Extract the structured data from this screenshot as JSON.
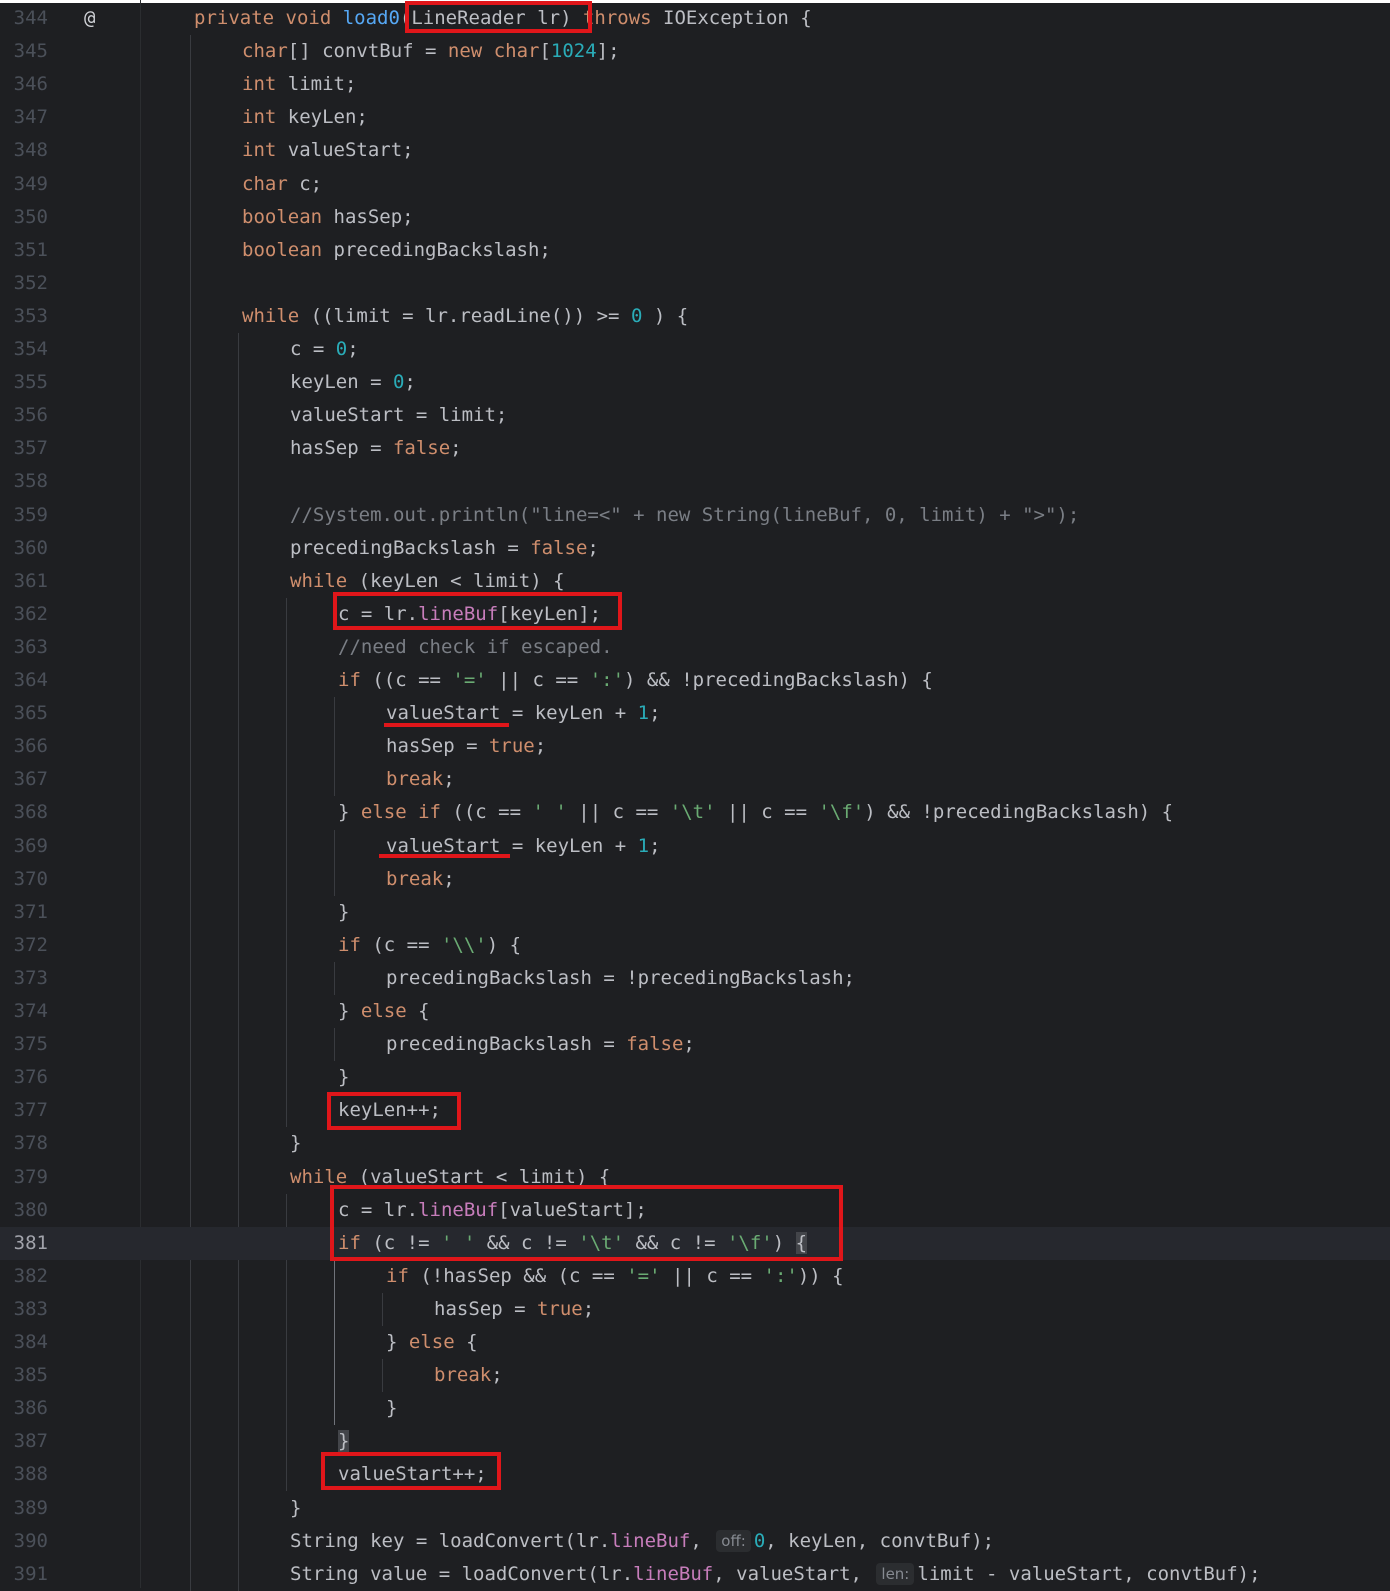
{
  "editor": {
    "lines": [
      {
        "n": "344",
        "indent": 0,
        "marker": "@",
        "tokens": [
          [
            "kw",
            "private"
          ],
          [
            "",
            ""
          ],
          [
            "kw",
            " void "
          ],
          [
            "fn",
            "load0"
          ],
          [
            "",
            "(LineReader lr) "
          ],
          [
            "kw",
            "throws"
          ],
          [
            "",
            " IOException {"
          ]
        ]
      },
      {
        "n": "345",
        "indent": 1,
        "tokens": [
          [
            "kw",
            "char"
          ],
          [
            "",
            "[] convtBuf = "
          ],
          [
            "kw",
            "new "
          ],
          [
            "kw",
            "char"
          ],
          [
            "",
            "["
          ],
          [
            "num",
            "1024"
          ],
          [
            "",
            "];"
          ]
        ]
      },
      {
        "n": "346",
        "indent": 1,
        "tokens": [
          [
            "kw",
            "int"
          ],
          [
            "",
            " limit;"
          ]
        ]
      },
      {
        "n": "347",
        "indent": 1,
        "tokens": [
          [
            "kw",
            "int"
          ],
          [
            "",
            " keyLen;"
          ]
        ]
      },
      {
        "n": "348",
        "indent": 1,
        "tokens": [
          [
            "kw",
            "int"
          ],
          [
            "",
            " valueStart;"
          ]
        ]
      },
      {
        "n": "349",
        "indent": 1,
        "tokens": [
          [
            "kw",
            "char"
          ],
          [
            "",
            " c;"
          ]
        ]
      },
      {
        "n": "350",
        "indent": 1,
        "tokens": [
          [
            "kw",
            "boolean"
          ],
          [
            "",
            " hasSep;"
          ]
        ]
      },
      {
        "n": "351",
        "indent": 1,
        "tokens": [
          [
            "kw",
            "boolean"
          ],
          [
            "",
            " precedingBackslash;"
          ]
        ]
      },
      {
        "n": "352",
        "indent": 1,
        "tokens": []
      },
      {
        "n": "353",
        "indent": 1,
        "tokens": [
          [
            "kw",
            "while"
          ],
          [
            "",
            " ((limit = lr.readLine()) >= "
          ],
          [
            "num",
            "0"
          ],
          [
            "",
            " ) {"
          ]
        ]
      },
      {
        "n": "354",
        "indent": 2,
        "tokens": [
          [
            "",
            "c = "
          ],
          [
            "num",
            "0"
          ],
          [
            "",
            ";"
          ]
        ]
      },
      {
        "n": "355",
        "indent": 2,
        "tokens": [
          [
            "",
            "keyLen = "
          ],
          [
            "num",
            "0"
          ],
          [
            "",
            ";"
          ]
        ]
      },
      {
        "n": "356",
        "indent": 2,
        "tokens": [
          [
            "",
            "valueStart = limit;"
          ]
        ]
      },
      {
        "n": "357",
        "indent": 2,
        "tokens": [
          [
            "",
            "hasSep = "
          ],
          [
            "kw",
            "false"
          ],
          [
            "",
            ";"
          ]
        ]
      },
      {
        "n": "358",
        "indent": 2,
        "tokens": []
      },
      {
        "n": "359",
        "indent": 2,
        "tokens": [
          [
            "cmt",
            "//System.out.println(\"line=<\" + new String(lineBuf, 0, limit) + \">\");"
          ]
        ]
      },
      {
        "n": "360",
        "indent": 2,
        "tokens": [
          [
            "",
            "precedingBackslash = "
          ],
          [
            "kw",
            "false"
          ],
          [
            "",
            ";"
          ]
        ]
      },
      {
        "n": "361",
        "indent": 2,
        "tokens": [
          [
            "kw",
            "while"
          ],
          [
            "",
            " (keyLen < limit) {"
          ]
        ]
      },
      {
        "n": "362",
        "indent": 3,
        "tokens": [
          [
            "",
            "c = lr."
          ],
          [
            "fld",
            "lineBuf"
          ],
          [
            "",
            "[keyLen];"
          ]
        ]
      },
      {
        "n": "363",
        "indent": 3,
        "tokens": [
          [
            "cmt",
            "//need check if escaped."
          ]
        ]
      },
      {
        "n": "364",
        "indent": 3,
        "tokens": [
          [
            "kw",
            "if"
          ],
          [
            "",
            " ((c == "
          ],
          [
            "str",
            "'='"
          ],
          [
            "",
            " || c == "
          ],
          [
            "str",
            "':'"
          ],
          [
            "",
            ") && !precedingBackslash) {"
          ]
        ]
      },
      {
        "n": "365",
        "indent": 4,
        "tokens": [
          [
            "",
            "valueStart = keyLen + "
          ],
          [
            "num",
            "1"
          ],
          [
            "",
            ";"
          ]
        ]
      },
      {
        "n": "366",
        "indent": 4,
        "tokens": [
          [
            "",
            "hasSep = "
          ],
          [
            "kw",
            "true"
          ],
          [
            "",
            ";"
          ]
        ]
      },
      {
        "n": "367",
        "indent": 4,
        "tokens": [
          [
            "kw",
            "break"
          ],
          [
            "",
            ";"
          ]
        ]
      },
      {
        "n": "368",
        "indent": 3,
        "tokens": [
          [
            "",
            "} "
          ],
          [
            "kw",
            "else if"
          ],
          [
            "",
            " ((c == "
          ],
          [
            "str",
            "' '"
          ],
          [
            "",
            " || c == "
          ],
          [
            "str",
            "'\\t'"
          ],
          [
            "",
            " || c == "
          ],
          [
            "str",
            "'\\f'"
          ],
          [
            "",
            ") && !precedingBackslash) {"
          ]
        ]
      },
      {
        "n": "369",
        "indent": 4,
        "tokens": [
          [
            "",
            "valueStart = keyLen + "
          ],
          [
            "num",
            "1"
          ],
          [
            "",
            ";"
          ]
        ]
      },
      {
        "n": "370",
        "indent": 4,
        "tokens": [
          [
            "kw",
            "break"
          ],
          [
            "",
            ";"
          ]
        ]
      },
      {
        "n": "371",
        "indent": 3,
        "tokens": [
          [
            "",
            "}"
          ]
        ]
      },
      {
        "n": "372",
        "indent": 3,
        "tokens": [
          [
            "kw",
            "if"
          ],
          [
            "",
            " (c == "
          ],
          [
            "str",
            "'\\\\'"
          ],
          [
            "",
            ") {"
          ]
        ]
      },
      {
        "n": "373",
        "indent": 4,
        "tokens": [
          [
            "",
            "precedingBackslash = !precedingBackslash;"
          ]
        ]
      },
      {
        "n": "374",
        "indent": 3,
        "tokens": [
          [
            "",
            "} "
          ],
          [
            "kw",
            "else"
          ],
          [
            "",
            " {"
          ]
        ]
      },
      {
        "n": "375",
        "indent": 4,
        "tokens": [
          [
            "",
            "precedingBackslash = "
          ],
          [
            "kw",
            "false"
          ],
          [
            "",
            ";"
          ]
        ]
      },
      {
        "n": "376",
        "indent": 3,
        "tokens": [
          [
            "",
            "}"
          ]
        ]
      },
      {
        "n": "377",
        "indent": 3,
        "tokens": [
          [
            "",
            "keyLen++;"
          ]
        ]
      },
      {
        "n": "378",
        "indent": 2,
        "tokens": [
          [
            "",
            "}"
          ]
        ]
      },
      {
        "n": "379",
        "indent": 2,
        "tokens": [
          [
            "kw",
            "while"
          ],
          [
            "",
            " (valueStart < limit) {"
          ]
        ]
      },
      {
        "n": "380",
        "indent": 3,
        "tokens": [
          [
            "",
            "c = lr."
          ],
          [
            "fld",
            "lineBuf"
          ],
          [
            "",
            "[valueStart];"
          ]
        ]
      },
      {
        "n": "381",
        "indent": 3,
        "current": true,
        "tokens": [
          [
            "kw",
            "if"
          ],
          [
            "",
            " (c != "
          ],
          [
            "str",
            "' '"
          ],
          [
            "",
            " && c != "
          ],
          [
            "str",
            "'\\t'"
          ],
          [
            "",
            " && c != "
          ],
          [
            "str",
            "'\\f'"
          ],
          [
            "",
            ") "
          ],
          [
            "bracehl",
            "{"
          ]
        ]
      },
      {
        "n": "382",
        "indent": 4,
        "tokens": [
          [
            "kw",
            "if"
          ],
          [
            "",
            " (!hasSep && (c == "
          ],
          [
            "str",
            "'='"
          ],
          [
            "",
            " || c == "
          ],
          [
            "str",
            "':'"
          ],
          [
            "",
            ")) {"
          ]
        ]
      },
      {
        "n": "383",
        "indent": 5,
        "tokens": [
          [
            "",
            "hasSep = "
          ],
          [
            "kw",
            "true"
          ],
          [
            "",
            ";"
          ]
        ]
      },
      {
        "n": "384",
        "indent": 4,
        "tokens": [
          [
            "",
            "} "
          ],
          [
            "kw",
            "else"
          ],
          [
            "",
            " {"
          ]
        ]
      },
      {
        "n": "385",
        "indent": 5,
        "tokens": [
          [
            "kw",
            "break"
          ],
          [
            "",
            ";"
          ]
        ]
      },
      {
        "n": "386",
        "indent": 4,
        "tokens": [
          [
            "",
            "}"
          ]
        ]
      },
      {
        "n": "387",
        "indent": 3,
        "tokens": [
          [
            "bracehl",
            "}"
          ]
        ]
      },
      {
        "n": "388",
        "indent": 3,
        "tokens": [
          [
            "",
            "valueStart++;"
          ]
        ]
      },
      {
        "n": "389",
        "indent": 2,
        "tokens": [
          [
            "",
            "}"
          ]
        ]
      },
      {
        "n": "390",
        "indent": 2,
        "tokens": [
          [
            "",
            "String key = loadConvert(lr."
          ],
          [
            "fld",
            "lineBuf"
          ],
          [
            "",
            ", "
          ],
          [
            "hint",
            "off:"
          ],
          [
            "num",
            "0"
          ],
          [
            "",
            ", keyLen, convtBuf);"
          ]
        ]
      },
      {
        "n": "391",
        "indent": 2,
        "tokens": [
          [
            "",
            "String value = loadConvert(lr."
          ],
          [
            "fld",
            "lineBuf"
          ],
          [
            "",
            ", valueStart, "
          ],
          [
            "hint",
            "len:"
          ],
          [
            "",
            "limit - valueStart, convtBuf);"
          ]
        ]
      }
    ]
  }
}
